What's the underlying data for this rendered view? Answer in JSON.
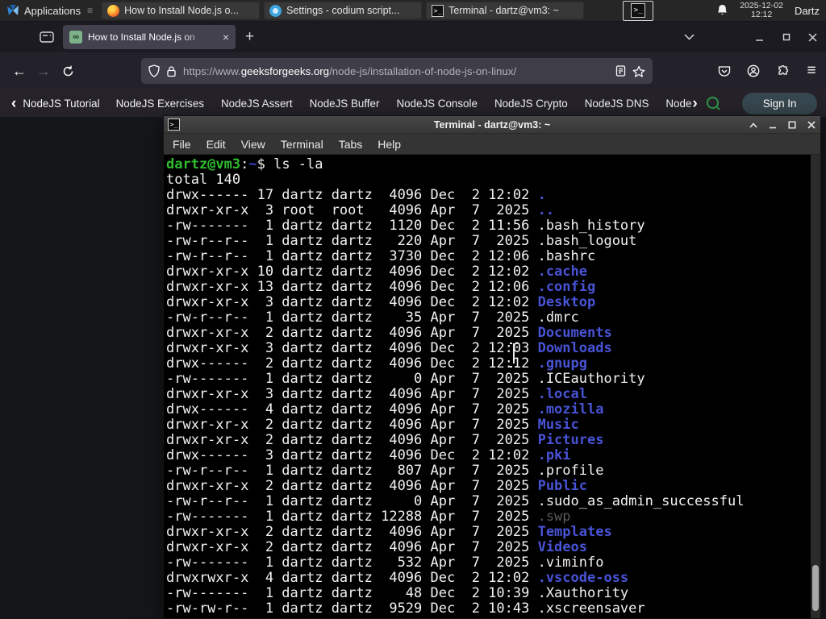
{
  "colors": {
    "terminal_green": "#2fbe2f",
    "dir_blue": "#4853d6",
    "prompt_path_blue": "#3a43c8",
    "dim_gray": "#5a5a5a",
    "gfg_green": "#2f8d46"
  },
  "panel": {
    "applications_label": "Applications",
    "tasks": [
      {
        "title": "How to Install Node.js o..."
      },
      {
        "title": "Settings - codium script..."
      },
      {
        "title": "Terminal - dartz@vm3: ~"
      }
    ],
    "clock_date": "2025-12-02",
    "clock_time": "12:12",
    "user_label": "Dartz"
  },
  "browser": {
    "tab_title": "How to Install Node.js on",
    "favicon_glyph": "∞",
    "new_tab_label": "+",
    "url_prefix": "https://www.",
    "url_domain": "geeksforgeeks.org",
    "url_path": "/node-js/installation-of-node-js-on-linux/"
  },
  "gfg_nav": {
    "back_item": "NodeJS Tutorial",
    "items": [
      "NodeJS Exercises",
      "NodeJS Assert",
      "NodeJS Buffer",
      "NodeJS Console",
      "NodeJS Crypto",
      "NodeJS DNS",
      "Node"
    ],
    "signin_label": "Sign In"
  },
  "terminal": {
    "title": "Terminal - dartz@vm3: ~",
    "menus": [
      "File",
      "Edit",
      "View",
      "Terminal",
      "Tabs",
      "Help"
    ],
    "prompt_user": "dartz@vm3",
    "prompt_sep": ":",
    "prompt_path": "~",
    "prompt_cmd": "$ ls -la",
    "total_line": "total 140",
    "rows": [
      {
        "pre": "drwx------ 17 dartz dartz  4096 Dec  2 12:02 ",
        "name": ".",
        "color": "dir"
      },
      {
        "pre": "drwxr-xr-x  3 root  root   4096 Apr  7  2025 ",
        "name": "..",
        "color": "dir"
      },
      {
        "pre": "-rw-------  1 dartz dartz  1120 Dec  2 11:56 ",
        "name": ".bash_history",
        "color": "plain"
      },
      {
        "pre": "-rw-r--r--  1 dartz dartz   220 Apr  7  2025 ",
        "name": ".bash_logout",
        "color": "plain"
      },
      {
        "pre": "-rw-r--r--  1 dartz dartz  3730 Dec  2 12:06 ",
        "name": ".bashrc",
        "color": "plain"
      },
      {
        "pre": "drwxr-xr-x 10 dartz dartz  4096 Dec  2 12:02 ",
        "name": ".cache",
        "color": "dir"
      },
      {
        "pre": "drwxr-xr-x 13 dartz dartz  4096 Dec  2 12:06 ",
        "name": ".config",
        "color": "dir"
      },
      {
        "pre": "drwxr-xr-x  3 dartz dartz  4096 Dec  2 12:02 ",
        "name": "Desktop",
        "color": "dir"
      },
      {
        "pre": "-rw-r--r--  1 dartz dartz    35 Apr  7  2025 ",
        "name": ".dmrc",
        "color": "plain"
      },
      {
        "pre": "drwxr-xr-x  2 dartz dartz  4096 Apr  7  2025 ",
        "name": "Documents",
        "color": "dir"
      },
      {
        "pre": "drwxr-xr-x  3 dartz dartz  4096 Dec  2 12:03 ",
        "name": "Downloads",
        "color": "dir"
      },
      {
        "pre": "drwx------  2 dartz dartz  4096 Dec  2 12:12 ",
        "name": ".gnupg",
        "color": "dir"
      },
      {
        "pre": "-rw-------  1 dartz dartz     0 Apr  7  2025 ",
        "name": ".ICEauthority",
        "color": "plain"
      },
      {
        "pre": "drwxr-xr-x  3 dartz dartz  4096 Apr  7  2025 ",
        "name": ".local",
        "color": "dir"
      },
      {
        "pre": "drwx------  4 dartz dartz  4096 Apr  7  2025 ",
        "name": ".mozilla",
        "color": "dir"
      },
      {
        "pre": "drwxr-xr-x  2 dartz dartz  4096 Apr  7  2025 ",
        "name": "Music",
        "color": "dir"
      },
      {
        "pre": "drwxr-xr-x  2 dartz dartz  4096 Apr  7  2025 ",
        "name": "Pictures",
        "color": "dir"
      },
      {
        "pre": "drwx------  3 dartz dartz  4096 Dec  2 12:02 ",
        "name": ".pki",
        "color": "dir"
      },
      {
        "pre": "-rw-r--r--  1 dartz dartz   807 Apr  7  2025 ",
        "name": ".profile",
        "color": "plain"
      },
      {
        "pre": "drwxr-xr-x  2 dartz dartz  4096 Apr  7  2025 ",
        "name": "Public",
        "color": "dir"
      },
      {
        "pre": "-rw-r--r--  1 dartz dartz     0 Apr  7  2025 ",
        "name": ".sudo_as_admin_successful",
        "color": "plain"
      },
      {
        "pre": "-rw-------  1 dartz dartz 12288 Apr  7  2025 ",
        "name": ".swp",
        "color": "dim"
      },
      {
        "pre": "drwxr-xr-x  2 dartz dartz  4096 Apr  7  2025 ",
        "name": "Templates",
        "color": "dir"
      },
      {
        "pre": "drwxr-xr-x  2 dartz dartz  4096 Apr  7  2025 ",
        "name": "Videos",
        "color": "dir"
      },
      {
        "pre": "-rw-------  1 dartz dartz   532 Apr  7  2025 ",
        "name": ".viminfo",
        "color": "plain"
      },
      {
        "pre": "drwxrwxr-x  4 dartz dartz  4096 Dec  2 12:02 ",
        "name": ".vscode-oss",
        "color": "dir"
      },
      {
        "pre": "-rw-------  1 dartz dartz    48 Dec  2 10:39 ",
        "name": ".Xauthority",
        "color": "plain"
      },
      {
        "pre": "-rw-rw-r--  1 dartz dartz  9529 Dec  2 10:43 ",
        "name": ".xscreensaver",
        "color": "plain"
      }
    ]
  }
}
